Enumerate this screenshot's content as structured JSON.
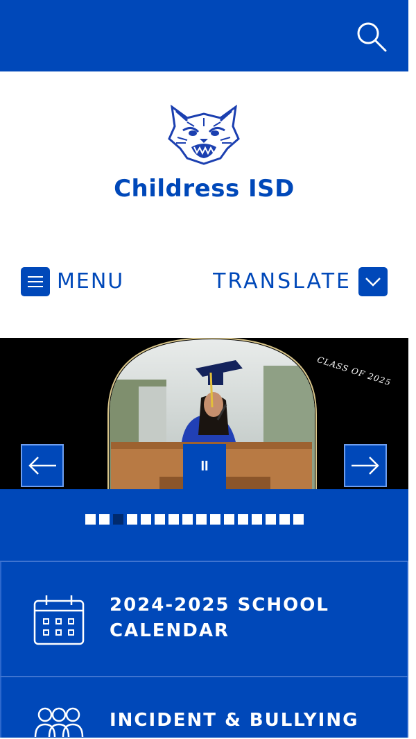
{
  "header": {
    "search_icon": "search-icon",
    "bg_color": "#0048b9"
  },
  "branding": {
    "logo": "wildcat-mascot-logo",
    "school_name": "Childress ISD"
  },
  "nav": {
    "menu_label": "MENU",
    "menu_icon": "hamburger-icon",
    "translate_label": "TRANSLATE",
    "translate_icon": "chevron-down-icon"
  },
  "slider": {
    "overlay_text": "CLASS OF 2025",
    "prev_icon": "arrow-left-icon",
    "next_icon": "arrow-right-icon",
    "pause_glyph": "II",
    "total_slides": 16,
    "active_slide": 3
  },
  "quick_links": [
    {
      "label_line1": "2024-2025 SCHOOL",
      "label_line2": "CALENDAR",
      "icon": "calendar-icon"
    },
    {
      "label_line1": "INCIDENT & BULLYING",
      "label_line2": "",
      "icon": "people-icon"
    }
  ],
  "colors": {
    "brand_blue": "#0048b9",
    "dot_active": "#002a6e"
  }
}
